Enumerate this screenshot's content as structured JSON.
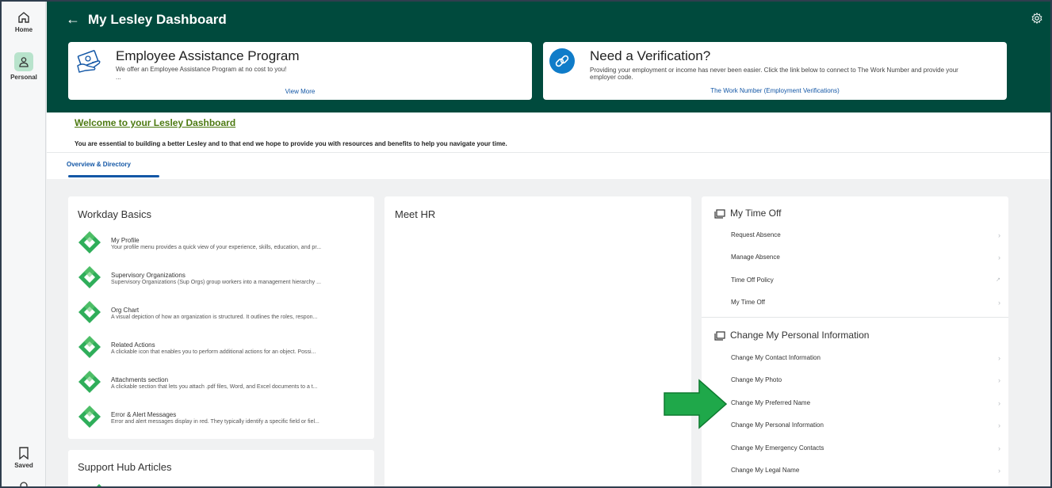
{
  "rail": {
    "home_label": "Home",
    "personal_label": "Personal",
    "saved_label": "Saved"
  },
  "header": {
    "title": "My Lesley Dashboard"
  },
  "eap_card": {
    "title": "Employee Assistance Program",
    "text": "We offer an Employee Assistance Program at no cost to you!",
    "ellipsis": "...",
    "link": "View More"
  },
  "verification_card": {
    "title": "Need a Verification?",
    "text_line1": "Providing your employment or income has never been easier. Click the link below to connect to The Work Number and provide your",
    "text_line2": "employer code.",
    "link": "The Work Number (Employment Verifications)"
  },
  "welcome": {
    "title": "Welcome to your Lesley Dashboard",
    "text": "You are essential to building a better Lesley and to that end we hope to provide you with resources and benefits to help you navigate your time."
  },
  "tabs": [
    {
      "label": "Overview & Directory"
    }
  ],
  "workday_basics": {
    "title": "Workday Basics",
    "items": [
      {
        "title": "My Profile",
        "desc": "Your profile menu provides a quick view of your experience, skills, education, and pr..."
      },
      {
        "title": "Supervisory Organizations",
        "desc": "Supervisory Organizations (Sup Orgs) group workers into a management hierarchy ..."
      },
      {
        "title": "Org Chart",
        "desc": "A visual depiction of how an organization is structured. It outlines the roles, respon..."
      },
      {
        "title": "Related Actions",
        "desc": "A clickable icon that enables you to perform additional actions for an object. Possi..."
      },
      {
        "title": "Attachments section",
        "desc": "A clickable section that lets you attach .pdf files, Word, and Excel documents to a t..."
      },
      {
        "title": "Error & Alert Messages",
        "desc": "Error and alert messages display in red. They typically identify a specific field or fiel..."
      }
    ]
  },
  "support_hub": {
    "title": "Support Hub Articles"
  },
  "meet_hr": {
    "title": "Meet HR"
  },
  "time_off": {
    "title": "My Time Off",
    "items": [
      {
        "label": "Request Absence",
        "icon": "chevron-right"
      },
      {
        "label": "Manage Absence",
        "icon": "chevron-right"
      },
      {
        "label": "Time Off Policy",
        "icon": "external-link"
      },
      {
        "label": "My Time Off",
        "icon": "chevron-right"
      }
    ]
  },
  "personal_info": {
    "title": "Change My Personal Information",
    "items": [
      {
        "label": "Change My Contact Information"
      },
      {
        "label": "Change My Photo"
      },
      {
        "label": "Change My Preferred Name"
      },
      {
        "label": "Change My Personal Information"
      },
      {
        "label": "Change My Emergency Contacts"
      },
      {
        "label": "Change My Legal Name"
      }
    ]
  },
  "colors": {
    "header_bg": "#004a3d",
    "accent_blue": "#1357a6",
    "welcome_green": "#4d7a12",
    "arrow_green": "#1fa84a"
  }
}
